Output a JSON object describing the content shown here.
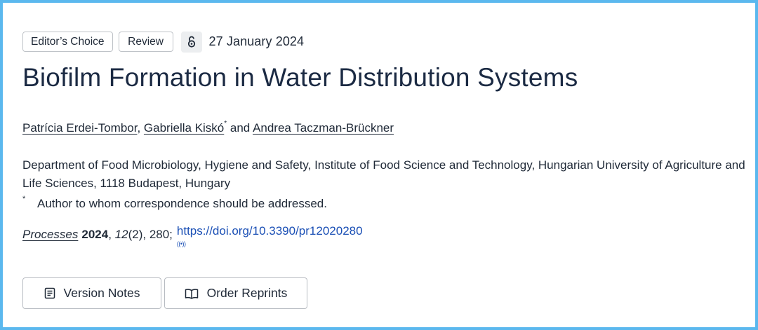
{
  "badges": {
    "editors_choice": "Editor’s Choice",
    "review": "Review",
    "open_access_icon": "open-access-icon",
    "date": "27 January 2024"
  },
  "article": {
    "title": "Biofilm Formation in Water Distribution Systems",
    "authors": [
      {
        "name": "Patrícia Erdei-Tombor",
        "sep": ","
      },
      {
        "name": "Gabriella Kiskó",
        "mark": "*",
        "sep": "and"
      },
      {
        "name": "Andrea Taczman-Brückner"
      }
    ],
    "affiliation": "Department of Food Microbiology, Hygiene and Safety, Institute of Food Science and Technology, Hungarian University of Agriculture and Life Sciences, 1118 Budapest, Hungary",
    "correspondence_mark": "*",
    "correspondence": "Author to whom correspondence should be addressed."
  },
  "citation": {
    "journal": "Processes",
    "year": "2024",
    "sep1": ",",
    "volume": "12",
    "issue_pages": "(2), 280;",
    "doi": "https://doi.org/10.3390/pr12020280",
    "cite_icon": "((•))"
  },
  "actions": {
    "version_notes": "Version Notes",
    "order_reprints": "Order Reprints",
    "version_icon": "notes-icon",
    "reprints_icon": "book-icon"
  }
}
